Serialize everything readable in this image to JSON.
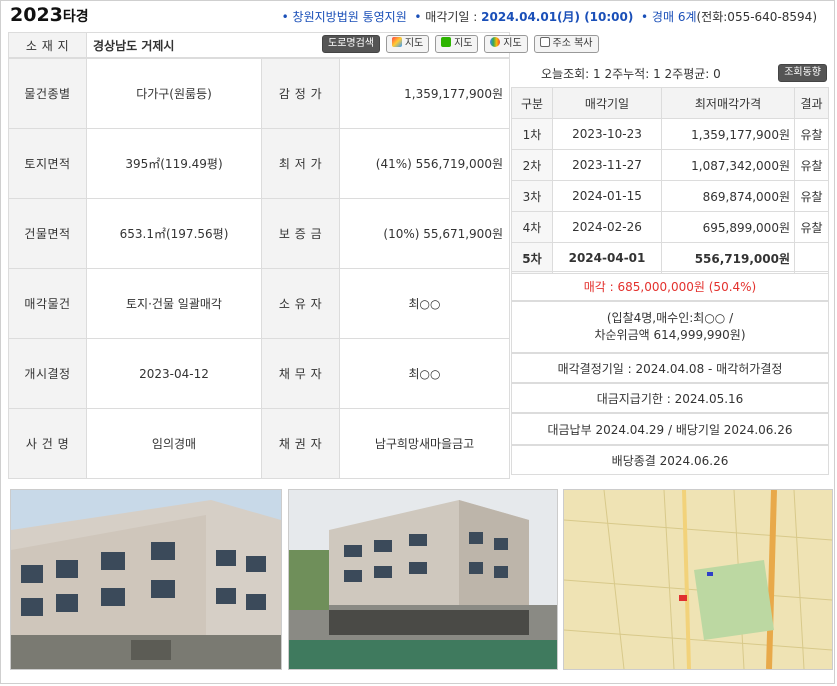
{
  "header": {
    "case_year": "2023",
    "case_type": "타경",
    "court": "창원지방법원 통영지원",
    "sale_date_label": "매각기일 : ",
    "sale_date": "2024.04.01(月) (10:00)",
    "dept": "경매 6계",
    "phone": "(전화:055-640-8594)"
  },
  "address": {
    "label": "소 재 지",
    "value": "경상남도 거제시",
    "buttons": [
      "도로명검색",
      "지도",
      "지도",
      "지도",
      "주소 복사"
    ]
  },
  "rows": [
    {
      "l1": "물건종별",
      "v1": "다가구(원룸등)",
      "l2": "감 정 가",
      "v2": "1,359,177,900원"
    },
    {
      "l1": "토지면적",
      "v1": "395㎡(119.49평)",
      "l2": "최 저 가",
      "v2": "(41%) 556,719,000원"
    },
    {
      "l1": "건물면적",
      "v1": "653.1㎡(197.56평)",
      "l2": "보 증 금",
      "v2": "(10%) 55,671,900원"
    },
    {
      "l1": "매각물건",
      "v1": "토지·건물 일괄매각",
      "l2": "소 유 자",
      "v2": "최○○"
    },
    {
      "l1": "개시결정",
      "v1": "2023-04-12",
      "l2": "채 무 자",
      "v2": "최○○"
    },
    {
      "l1": "사 건 명",
      "v1": "임의경매",
      "l2": "채 권 자",
      "v2": "남구희망새마을금고"
    }
  ],
  "views": {
    "text": "오늘조회: 1  2주누적: 1  2주평균: 0",
    "button": "조회동향"
  },
  "history": {
    "headers": [
      "구분",
      "매각기일",
      "최저매각가격",
      "결과"
    ],
    "rows": [
      [
        "1차",
        "2023-10-23",
        "1,359,177,900원",
        "유찰"
      ],
      [
        "2차",
        "2023-11-27",
        "1,087,342,000원",
        "유찰"
      ],
      [
        "3차",
        "2024-01-15",
        "869,874,000원",
        "유찰"
      ],
      [
        "4차",
        "2024-02-26",
        "695,899,000원",
        "유찰"
      ],
      [
        "5차",
        "2024-04-01",
        "556,719,000원",
        ""
      ]
    ]
  },
  "result": {
    "sold_label": "매각 : ",
    "sold_price": "685,000,000원",
    "sold_pct": "(50.4%)",
    "bid_line1": "(입찰4명,매수인:최○○ /",
    "bid_line2": "차순위금액 614,999,990원)",
    "decision": "매각결정기일 : 2024.04.08 - 매각허가결정",
    "deadline": "대금지급기한 : 2024.05.16",
    "payment": "대금납부 2024.04.29 / 배당기일 2024.06.26",
    "closed": "배당종결 2024.06.26"
  },
  "colors": {
    "accent_blue": "#1a4fb8",
    "red": "#e3312d",
    "label_bg": "#f3f3f3"
  }
}
